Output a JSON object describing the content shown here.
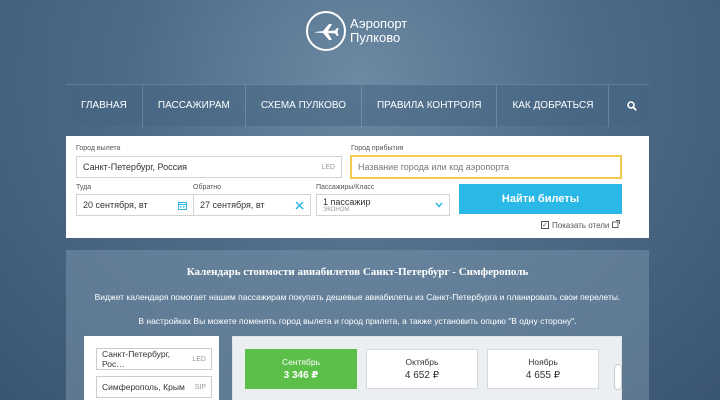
{
  "logo": {
    "line1": "Аэропорт",
    "line2": "Пулково"
  },
  "nav": {
    "items": [
      "ГЛАВНАЯ",
      "ПАССАЖИРАМ",
      "СХЕМА ПУЛКОВО",
      "ПРАВИЛА КОНТРОЛЯ",
      "КАК ДОБРАТЬСЯ"
    ]
  },
  "form": {
    "departure_label": "Город вылета",
    "departure_value": "Санкт-Петербург, Россия",
    "departure_code": "LED",
    "arrival_label": "Город прибытия",
    "arrival_placeholder": "Название города или код аэропорта",
    "there_label": "Туда",
    "there_value": "20 сентября, вт",
    "back_label": "Обратно",
    "back_value": "27 сентября, вт",
    "pax_label": "Пассажиры/Класс",
    "pax_value": "1 пассажир",
    "pax_class": "ЭКОНОМ",
    "find_button": "Найти билеты",
    "hotels_label": "Показать отели",
    "hotels_checked": true
  },
  "calendar": {
    "title": "Календарь стоимости авиабилетов Санкт-Петербург - Симферополь",
    "desc1": "Виджет календаря помогает нашим пассажирам покупать дешевые авиабилеты из Санкт-Петербурга и планировать свои перелеты.",
    "desc2": "В настройках Вы можете поменять город вылета и город прилета, а также установить опцию \"В одну сторону\".",
    "from_value": "Санкт-Петербург, Рос…",
    "from_code": "LED",
    "to_value": "Симферополь, Крым",
    "to_code": "SIP",
    "months": [
      {
        "name": "Сентябрь",
        "price": "3 346 ₽",
        "active": true
      },
      {
        "name": "Октябрь",
        "price": "4 652 ₽",
        "active": false
      },
      {
        "name": "Ноябрь",
        "price": "4 655 ₽",
        "active": false
      }
    ]
  },
  "colors": {
    "accent": "#2ab8e6",
    "active_month": "#5cbf4a",
    "focus_border": "#f2c94c"
  }
}
